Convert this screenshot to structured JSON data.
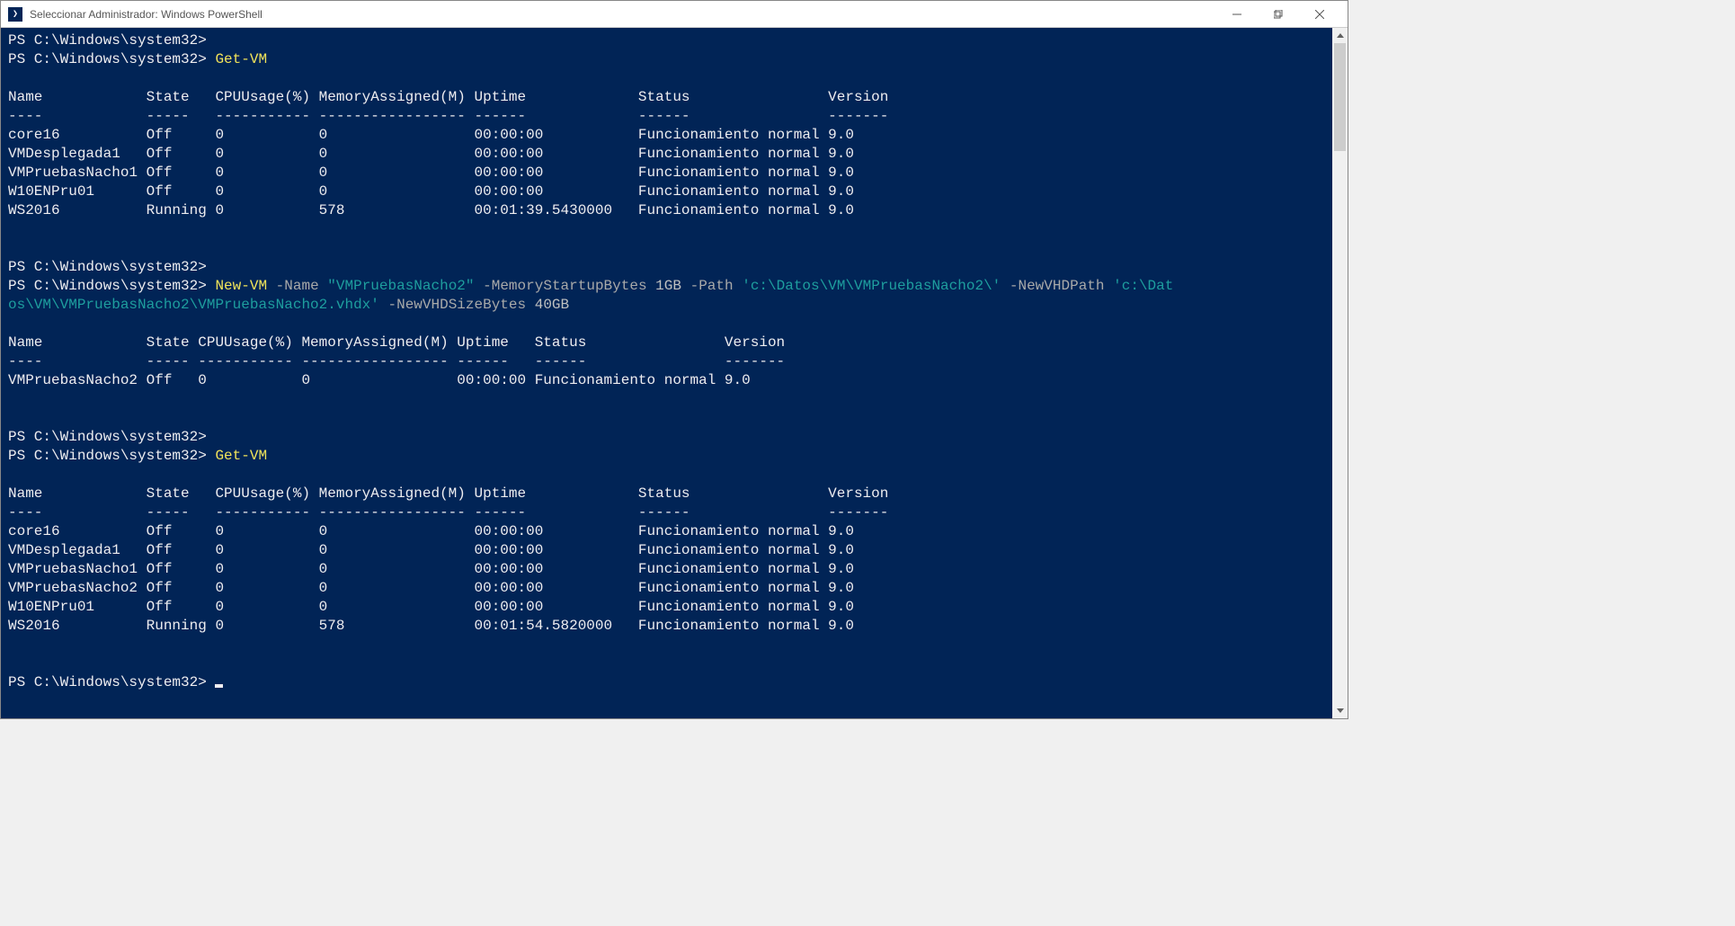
{
  "window": {
    "title": "Seleccionar Administrador: Windows PowerShell",
    "icon_glyph": "❯"
  },
  "prompt": "PS C:\\Windows\\system32> ",
  "commands": {
    "getvm": "Get-VM",
    "newvm": {
      "cmd": "New-VM",
      "p1": "-Name",
      "v1": "\"VMPruebasNacho2\"",
      "p2": "-MemoryStartupBytes",
      "v2": "1GB",
      "p3": "-Path",
      "v3": "'c:\\Datos\\VM\\VMPruebasNacho2\\'",
      "p4": "-NewVHDPath",
      "v4_a": "'c:\\Dat",
      "v4_b": "os\\VM\\VMPruebasNacho2\\VMPruebasNacho2.vhdx'",
      "p5": "-NewVHDSizeBytes",
      "v5": "40GB"
    }
  },
  "table1": {
    "header": "Name            State   CPUUsage(%) MemoryAssigned(M) Uptime             Status                Version",
    "divider": "----            -----   ----------- ----------------- ------             ------                -------",
    "rows": [
      "core16          Off     0           0                 00:00:00           Funcionamiento normal 9.0",
      "VMDesplegada1   Off     0           0                 00:00:00           Funcionamiento normal 9.0",
      "VMPruebasNacho1 Off     0           0                 00:00:00           Funcionamiento normal 9.0",
      "W10ENPru01      Off     0           0                 00:00:00           Funcionamiento normal 9.0",
      "WS2016          Running 0           578               00:01:39.5430000   Funcionamiento normal 9.0"
    ]
  },
  "table2": {
    "header": "Name            State CPUUsage(%) MemoryAssigned(M) Uptime   Status                Version",
    "divider": "----            ----- ----------- ----------------- ------   ------                -------",
    "rows": [
      "VMPruebasNacho2 Off   0           0                 00:00:00 Funcionamiento normal 9.0"
    ]
  },
  "table3": {
    "header": "Name            State   CPUUsage(%) MemoryAssigned(M) Uptime             Status                Version",
    "divider": "----            -----   ----------- ----------------- ------             ------                -------",
    "rows": [
      "core16          Off     0           0                 00:00:00           Funcionamiento normal 9.0",
      "VMDesplegada1   Off     0           0                 00:00:00           Funcionamiento normal 9.0",
      "VMPruebasNacho1 Off     0           0                 00:00:00           Funcionamiento normal 9.0",
      "VMPruebasNacho2 Off     0           0                 00:00:00           Funcionamiento normal 9.0",
      "W10ENPru01      Off     0           0                 00:00:00           Funcionamiento normal 9.0",
      "WS2016          Running 0           578               00:01:54.5820000   Funcionamiento normal 9.0"
    ]
  }
}
